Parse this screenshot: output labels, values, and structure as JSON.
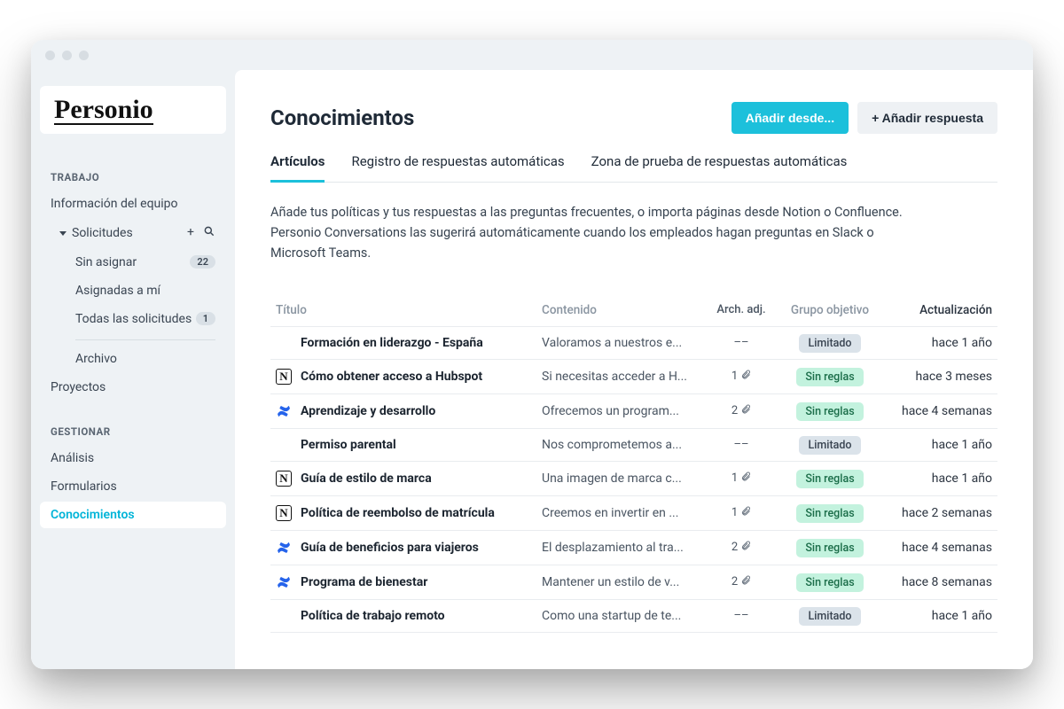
{
  "logo": "Personio",
  "sidebar": {
    "section1_label": "TRABAJO",
    "team_info": "Información del equipo",
    "requests": "Solicitudes",
    "unassigned": "Sin asignar",
    "unassigned_count": "22",
    "assigned_to_me": "Asignadas a mí",
    "all_requests": "Todas las solicitudes",
    "all_requests_count": "1",
    "archive": "Archivo",
    "projects": "Proyectos",
    "section2_label": "GESTIONAR",
    "analysis": "Análisis",
    "forms": "Formularios",
    "knowledge": "Conocimientos"
  },
  "page": {
    "title": "Conocimientos",
    "btn_add_from": "Añadir desde...",
    "btn_add_answer": "+ Añadir respuesta",
    "tab1": "Artículos",
    "tab2": "Registro de respuestas automáticas",
    "tab3": "Zona de prueba de respuestas automáticas",
    "intro": "Añade tus políticas y tus respuestas a las preguntas frecuentes, o importa páginas desde Notion o Confluence. Personio Conversations las sugerirá automáticamente cuando los empleados hagan preguntas en Slack o Microsoft Teams."
  },
  "columns": {
    "title": "Título",
    "content": "Contenido",
    "attachments": "Arch. adj.",
    "target_group": "Grupo objetivo",
    "updated": "Actualización"
  },
  "pill_labels": {
    "limited": "Limitado",
    "no_rules": "Sin reglas"
  },
  "rows": [
    {
      "source": "none",
      "title": "Formación en liderazgo - España",
      "content": "Valoramos a nuestros e...",
      "att": "––",
      "group": "limited",
      "updated": "hace 1 año"
    },
    {
      "source": "notion",
      "title": "Cómo obtener acceso a Hubspot",
      "content": "Si necesitas acceder a H...",
      "att": "1",
      "group": "no_rules",
      "updated": "hace 3 meses"
    },
    {
      "source": "confluence",
      "title": "Aprendizaje y desarrollo",
      "content": "Ofrecemos un program...",
      "att": "2",
      "group": "no_rules",
      "updated": "hace 4 semanas"
    },
    {
      "source": "none",
      "title": "Permiso parental",
      "content": "Nos comprometemos a...",
      "att": "––",
      "group": "limited",
      "updated": "hace 1 año"
    },
    {
      "source": "notion",
      "title": "Guía de estilo de marca",
      "content": "Una imagen de marca c...",
      "att": "1",
      "group": "no_rules",
      "updated": "hace 1 año"
    },
    {
      "source": "notion",
      "title": "Política de reembolso de matrícula",
      "content": "Creemos en invertir en ...",
      "att": "1",
      "group": "no_rules",
      "updated": "hace 2 semanas"
    },
    {
      "source": "confluence",
      "title": "Guía de beneficios para viajeros",
      "content": "El desplazamiento al tra...",
      "att": "2",
      "group": "no_rules",
      "updated": "hace 4 semanas"
    },
    {
      "source": "confluence",
      "title": "Programa de bienestar",
      "content": "Mantener un estilo de v...",
      "att": "2",
      "group": "no_rules",
      "updated": "hace 8 semanas"
    },
    {
      "source": "none",
      "title": "Política de trabajo remoto",
      "content": "Como una startup de te...",
      "att": "––",
      "group": "limited",
      "updated": "hace 1 año"
    }
  ]
}
